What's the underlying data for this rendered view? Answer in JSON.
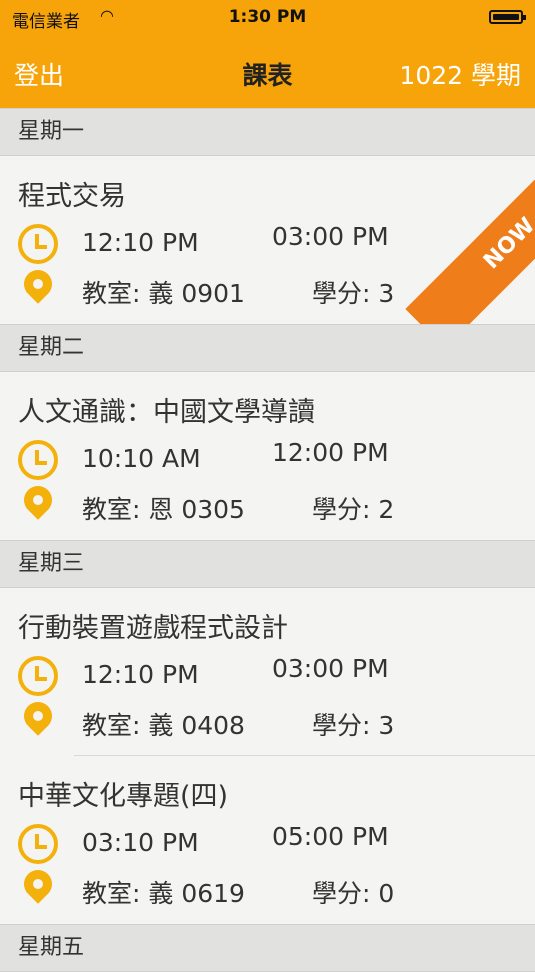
{
  "status_bar": {
    "carrier": "電信業者",
    "wifi_icon": "wifi-icon",
    "time": "1:30 PM",
    "battery_icon": "battery-icon"
  },
  "nav": {
    "logout_label": "登出",
    "title": "課表",
    "term_label": "1022 學期"
  },
  "colors": {
    "accent": "#f7a30a",
    "icon": "#f4b00b",
    "now_ribbon": "#ef7d1a"
  },
  "sections": [
    {
      "day": "星期一",
      "courses": [
        {
          "name": "程式交易",
          "start": "12:10 PM",
          "end": "03:00 PM",
          "room": "教室: 義 0901",
          "credit": "學分: 3",
          "badge": "NOW"
        }
      ]
    },
    {
      "day": "星期二",
      "courses": [
        {
          "name": "人文通識：中國文學導讀",
          "start": "10:10 AM",
          "end": "12:00 PM",
          "room": "教室: 恩 0305",
          "credit": "學分: 2"
        }
      ]
    },
    {
      "day": "星期三",
      "courses": [
        {
          "name": "行動裝置遊戲程式設計",
          "start": "12:10 PM",
          "end": "03:00 PM",
          "room": "教室: 義 0408",
          "credit": "學分: 3"
        },
        {
          "name": "中華文化專題(四)",
          "start": "03:10 PM",
          "end": "05:00 PM",
          "room": "教室: 義 0619",
          "credit": "學分: 0"
        }
      ]
    },
    {
      "day": "星期五",
      "courses": []
    }
  ]
}
